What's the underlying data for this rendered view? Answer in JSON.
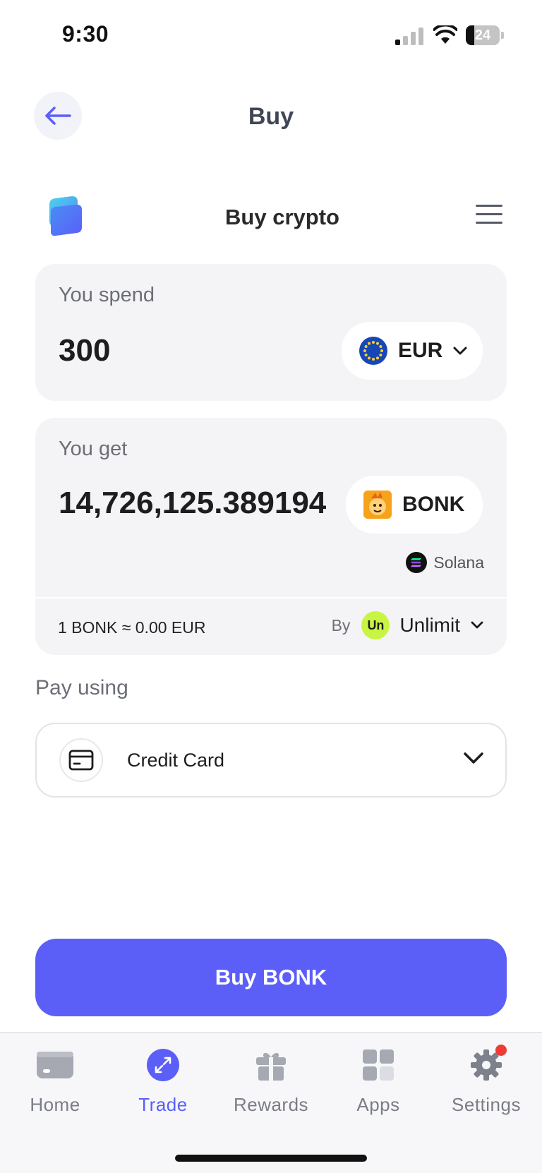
{
  "status_bar": {
    "time": "9:30",
    "battery": "24",
    "battery_level": 0.24
  },
  "header": {
    "title": "Buy"
  },
  "widget": {
    "title": "Buy crypto"
  },
  "spend": {
    "label": "You spend",
    "amount": "300",
    "currency": "EUR"
  },
  "get": {
    "label": "You get",
    "amount": "14,726,125.389194",
    "token": "BONK",
    "network": "Solana",
    "rate": "1 BONK ≈ 0.00 EUR",
    "provider_prefix": "By",
    "provider_logo_text": "Un",
    "provider": "Unlimit"
  },
  "payment": {
    "label": "Pay using",
    "method": "Credit Card"
  },
  "buy_button": {
    "label": "Buy BONK"
  },
  "tab_bar": {
    "tabs": [
      {
        "label": "Home",
        "icon": "wallet-card-icon"
      },
      {
        "label": "Trade",
        "icon": "trade-icon"
      },
      {
        "label": "Rewards",
        "icon": "gift-icon"
      },
      {
        "label": "Apps",
        "icon": "apps-grid-icon"
      },
      {
        "label": "Settings",
        "icon": "gear-icon"
      }
    ],
    "active": "Trade"
  },
  "colors": {
    "accent": "#5b5ff7",
    "provider_badge": "#c8f542",
    "notification_dot": "#ee3b34",
    "eur_blue": "#1747b7",
    "bonk_orange": "#f7a21b"
  }
}
